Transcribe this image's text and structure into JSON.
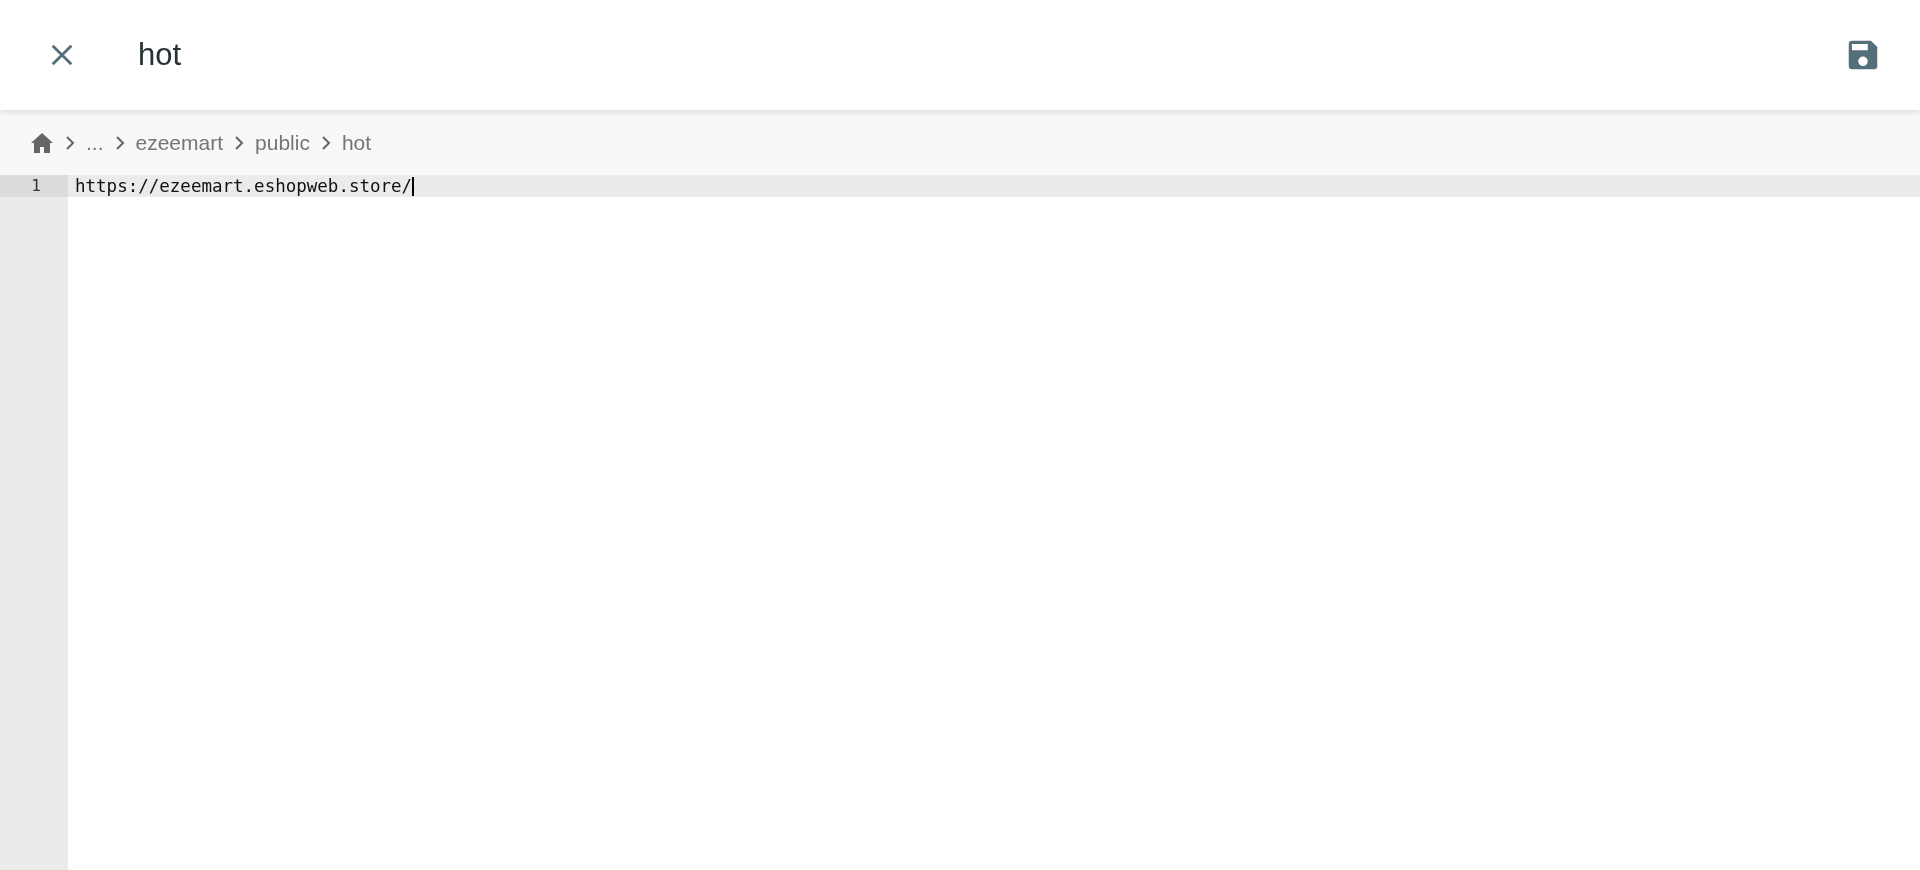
{
  "header": {
    "title": "hot"
  },
  "breadcrumb": [
    "...",
    "ezeemart",
    "public",
    "hot"
  ],
  "editor": {
    "lines": [
      {
        "number": "1",
        "text": "https://ezeemart.eshopweb.store/",
        "active": true
      }
    ]
  }
}
